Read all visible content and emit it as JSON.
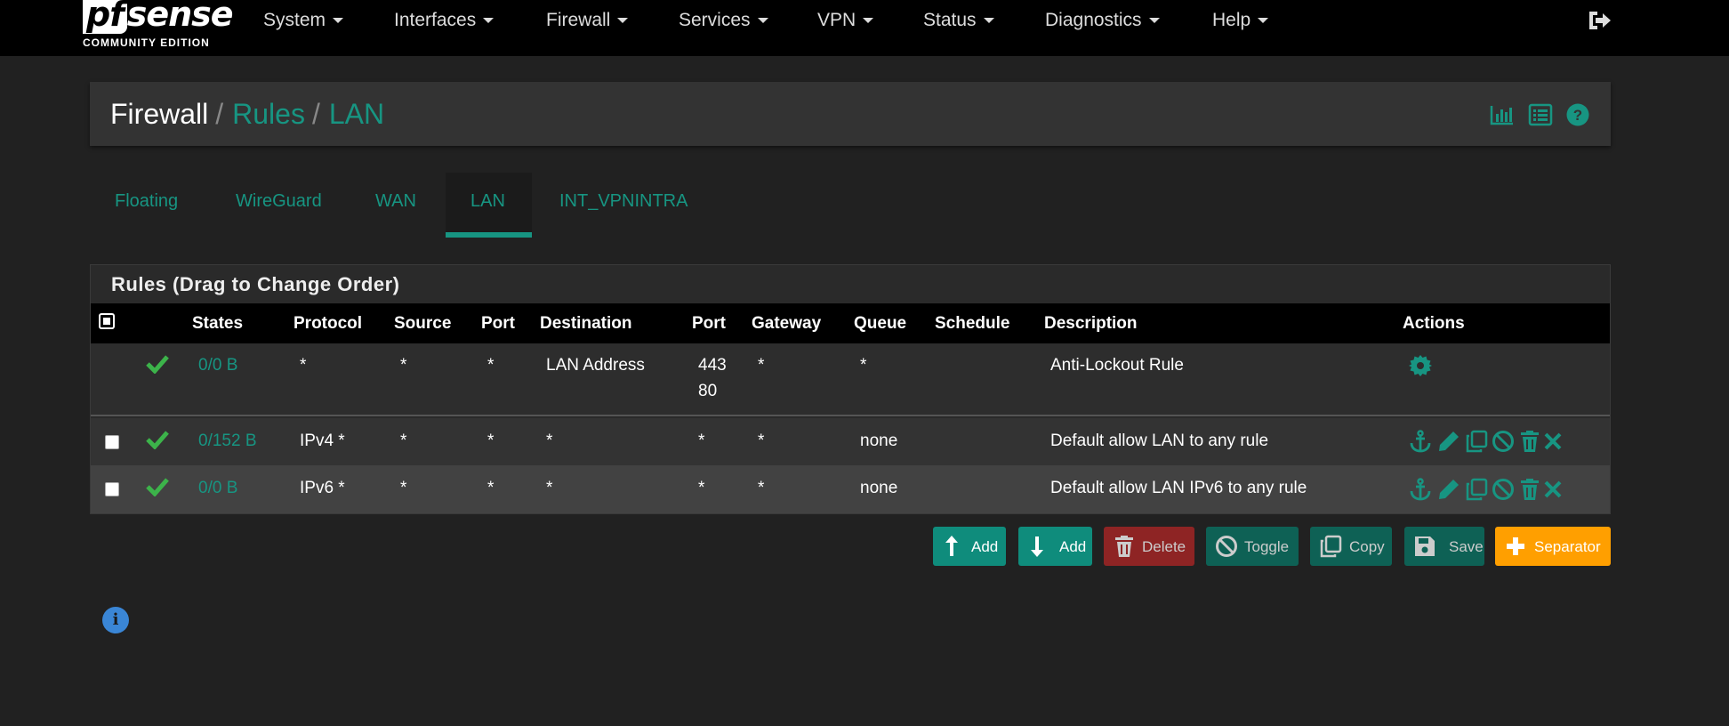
{
  "brand": {
    "logo_text": "sense",
    "logo_prefix": "pf",
    "edition": "COMMUNITY EDITION"
  },
  "nav": {
    "items": [
      {
        "label": "System"
      },
      {
        "label": "Interfaces"
      },
      {
        "label": "Firewall"
      },
      {
        "label": "Services"
      },
      {
        "label": "VPN"
      },
      {
        "label": "Status"
      },
      {
        "label": "Diagnostics"
      },
      {
        "label": "Help"
      }
    ],
    "logout_icon": "sign-out-icon"
  },
  "breadcrumb": {
    "items": [
      "Firewall",
      "Rules",
      "LAN"
    ],
    "separator": "/",
    "icons": [
      "bar-chart-icon",
      "list-icon",
      "help-icon"
    ]
  },
  "tabs": {
    "items": [
      {
        "label": "Floating"
      },
      {
        "label": "WireGuard"
      },
      {
        "label": "WAN"
      },
      {
        "label": "LAN"
      },
      {
        "label": "INT_VPNINTRA"
      }
    ],
    "active": "LAN"
  },
  "rules": {
    "title": "Rules (Drag to Change Order)",
    "columns": [
      "States",
      "Protocol",
      "Source",
      "Port",
      "Destination",
      "Port",
      "Gateway",
      "Queue",
      "Schedule",
      "Description",
      "Actions"
    ],
    "rows": [
      {
        "states": "0/0 B",
        "protocol": "*",
        "source": "*",
        "src_port": "*",
        "destination": "LAN Address",
        "dst_port": [
          "443",
          "80"
        ],
        "gateway": "*",
        "queue": "*",
        "schedule": "",
        "description": "Anti-Lockout Rule",
        "actions": [
          "gear-icon"
        ],
        "enabled": true
      },
      {
        "states": "0/152 B",
        "protocol": "IPv4 *",
        "source": "*",
        "src_port": "*",
        "destination": "*",
        "dst_port": [
          "*"
        ],
        "gateway": "*",
        "queue": "none",
        "schedule": "",
        "description": "Default allow LAN to any rule",
        "actions": [
          "anchor-icon",
          "pencil-icon",
          "copy-icon",
          "ban-icon",
          "trash-icon",
          "close-icon"
        ],
        "enabled": true
      },
      {
        "states": "0/0 B",
        "protocol": "IPv6 *",
        "source": "*",
        "src_port": "*",
        "destination": "*",
        "dst_port": [
          "*"
        ],
        "gateway": "*",
        "queue": "none",
        "schedule": "",
        "description": "Default allow LAN IPv6 to any rule",
        "actions": [
          "anchor-icon",
          "pencil-icon",
          "copy-icon",
          "ban-icon",
          "trash-icon",
          "close-icon"
        ],
        "enabled": true
      }
    ]
  },
  "buttons": {
    "add_top": "Add",
    "add_bottom": "Add",
    "delete": "Delete",
    "toggle": "Toggle",
    "copy": "Copy",
    "save": "Save",
    "separator": "Separator"
  },
  "colors": {
    "accent": "#179582",
    "navbar": "#000000",
    "background": "#212121",
    "danger": "#8e2424",
    "warning": "#ff9f00",
    "success": "#3cb34a"
  }
}
